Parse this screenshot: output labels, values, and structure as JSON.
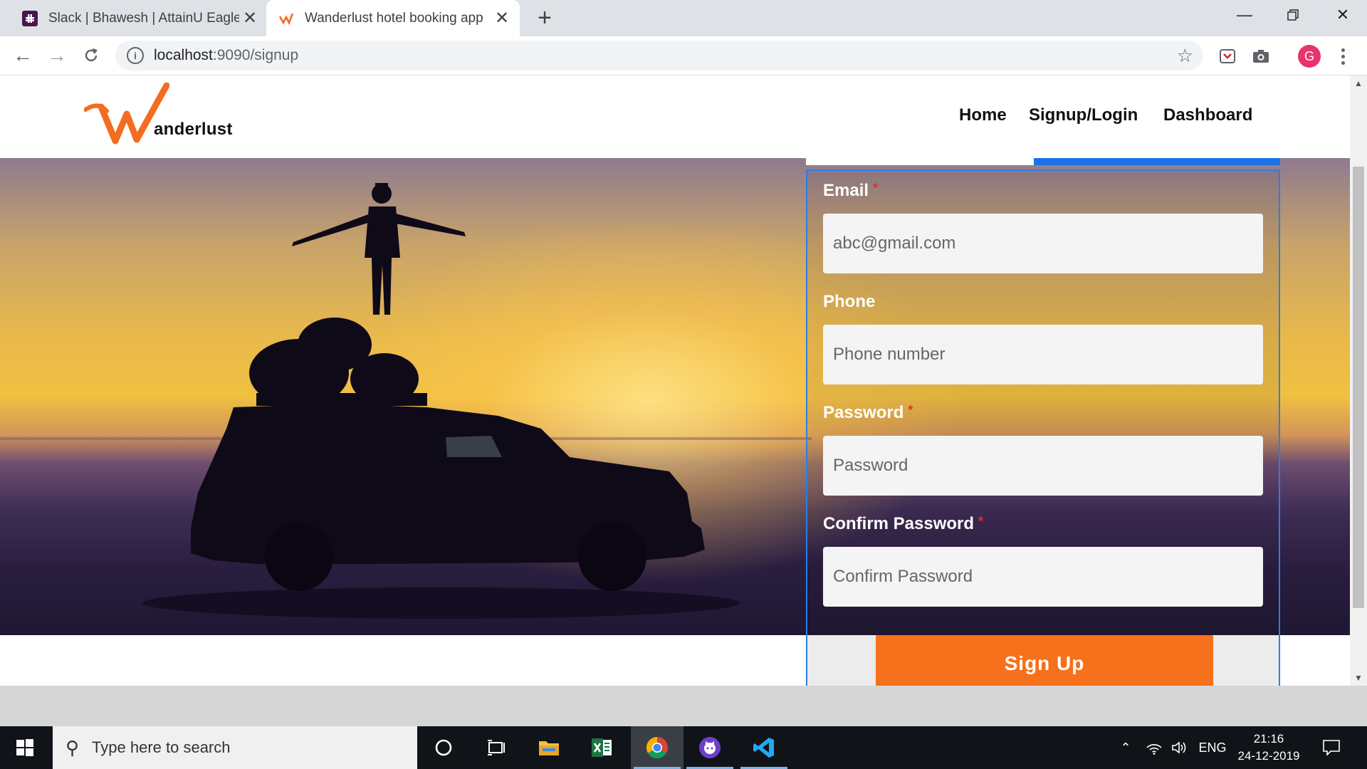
{
  "browser": {
    "tabs": [
      {
        "title": "Slack | Bhawesh | AttainU Eagle",
        "active": false
      },
      {
        "title": "Wanderlust hotel booking app",
        "active": true
      }
    ],
    "url_host": "localhost",
    "url_path": ":9090/signup",
    "profile_initial": "G"
  },
  "site": {
    "logo_letter": "W",
    "logo_text": "anderlust",
    "nav": [
      "Home",
      "Signup/Login",
      "Dashboard"
    ]
  },
  "form": {
    "email": {
      "label": "Email",
      "required": "*",
      "placeholder": "abc@gmail.com"
    },
    "phone": {
      "label": "Phone",
      "placeholder": "Phone number"
    },
    "password": {
      "label": "Password",
      "required": "*",
      "placeholder": "Password"
    },
    "confirm": {
      "label": "Confirm Password",
      "required": "*",
      "placeholder": "Confirm Password"
    },
    "submit_label": "Sign Up"
  },
  "taskbar": {
    "search_placeholder": "Type here to search",
    "language": "ENG",
    "time": "21:16",
    "date": "24-12-2019"
  },
  "colors": {
    "accent_orange": "#f7701b",
    "card_border": "#2b7de9",
    "required_star": "#e03030"
  }
}
